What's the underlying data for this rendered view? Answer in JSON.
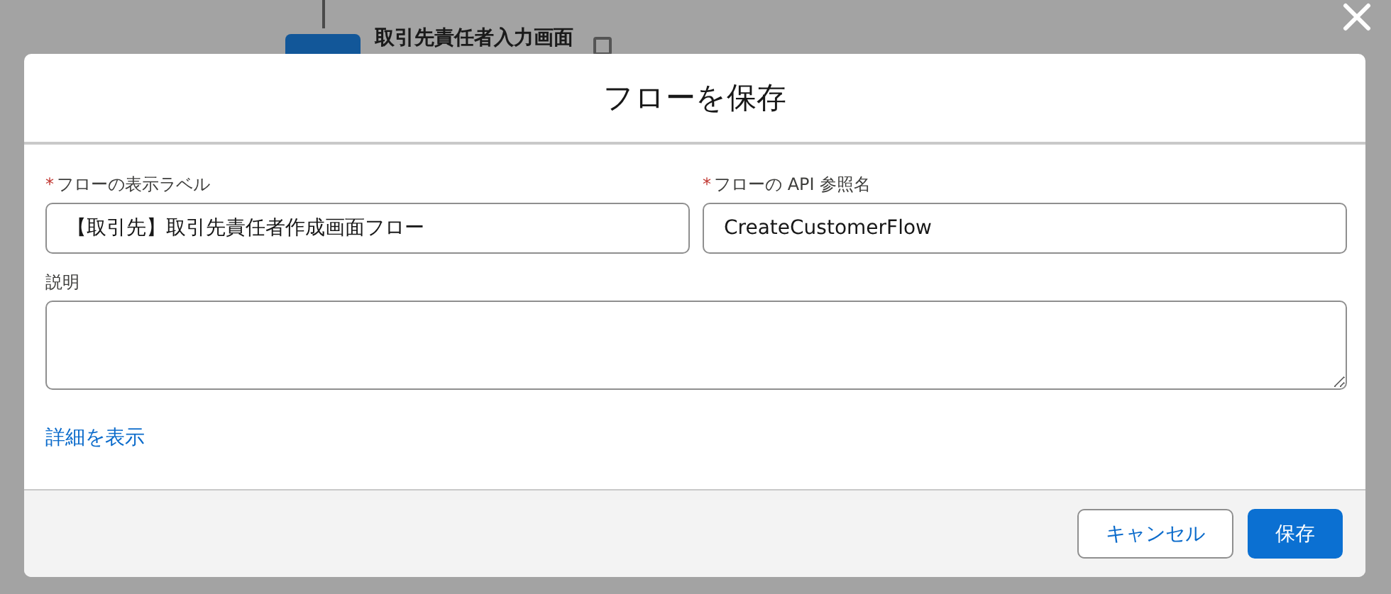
{
  "background": {
    "node_label": "取引先責任者入力画面"
  },
  "dialog": {
    "title": "フローを保存",
    "fields": [
      {
        "kind": "input",
        "label": "フローの表示ラベル",
        "required_mark": "*",
        "value": "【取引先】取引先責任者作成画面フロー"
      },
      {
        "kind": "input",
        "label": "フローの API 参照名",
        "required_mark": "*",
        "value": "CreateCustomerFlow"
      },
      {
        "kind": "textarea",
        "label": "説明"
      }
    ],
    "link": "詳細を表示",
    "buttons": [
      {
        "label": "キャンセル",
        "kind": "neutral"
      },
      {
        "label": "保存",
        "kind": "brand"
      }
    ]
  }
}
